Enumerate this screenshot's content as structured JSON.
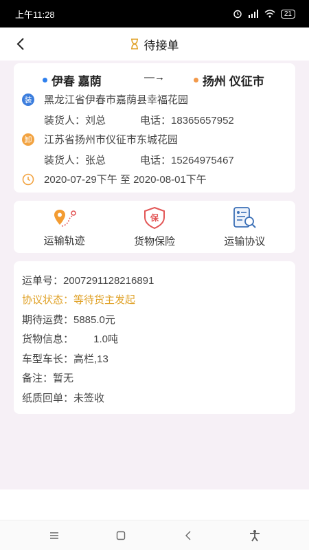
{
  "status_bar": {
    "time": "上午11:28",
    "network": "4G",
    "battery": "21"
  },
  "header": {
    "title": "待接单"
  },
  "route": {
    "origin": "伊春 嘉荫",
    "arrow": "—→",
    "destination": "扬州 仪征市",
    "load_badge": "装",
    "unload_badge": "卸",
    "load_address": "黑龙江省伊春市嘉荫县幸福花园",
    "load_contact": "装货人：刘总",
    "load_phone": "电话：18365657952",
    "unload_address": "江苏省扬州市仪征市东城花园",
    "unload_contact": "装货人：张总",
    "unload_phone": "电话：15264975467",
    "date_range": "2020-07-29下午 至 2020-08-01下午"
  },
  "actions": {
    "track": "运输轨迹",
    "insurance": "货物保险",
    "insurance_icon_text": "保",
    "agreement": "运输协议"
  },
  "waybill": {
    "number": "运单号：2007291128216891",
    "status": "协议状态：等待货主发起",
    "freight": "期待运费：5885.0元",
    "cargo": "货物信息：       1.0吨",
    "vehicle": "车型车长：高栏,13",
    "remark": "备注：暂无",
    "receipt": "纸质回单：未签收"
  },
  "colors": {
    "origin_dot": "#2f80ed",
    "destination_dot": "#f2994a",
    "load_badge": "#3b7ddd",
    "unload_badge": "#f2a341",
    "status_highlight": "#e0a228",
    "accent_red": "#e25555",
    "accent_orange": "#f39c32"
  }
}
